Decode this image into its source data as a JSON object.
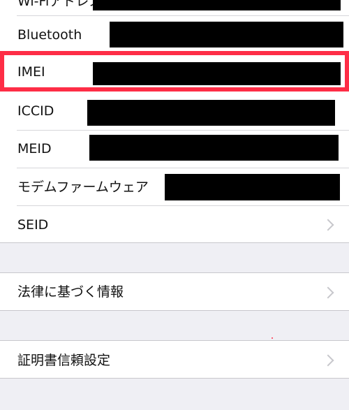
{
  "rows": [
    {
      "label": "Wi-Fiアドレス",
      "value_redacted": true
    },
    {
      "label": "Bluetooth",
      "value_redacted": true
    },
    {
      "label": "IMEI",
      "value_redacted": true,
      "highlighted": true
    },
    {
      "label": "ICCID",
      "value_redacted": true
    },
    {
      "label": "MEID",
      "value_redacted": true
    },
    {
      "label": "モデムファームウェア",
      "value_redacted": true
    },
    {
      "label": "SEID",
      "chevron": true
    }
  ],
  "legal": {
    "label": "法律に基づく情報",
    "chevron": true
  },
  "certificate": {
    "label": "証明書信頼設定",
    "chevron": true
  },
  "colors": {
    "highlight": "#fe2d46",
    "background": "#efeff4",
    "redaction": "#000000"
  },
  "icons": {
    "chevron": "chevron-right-icon"
  }
}
